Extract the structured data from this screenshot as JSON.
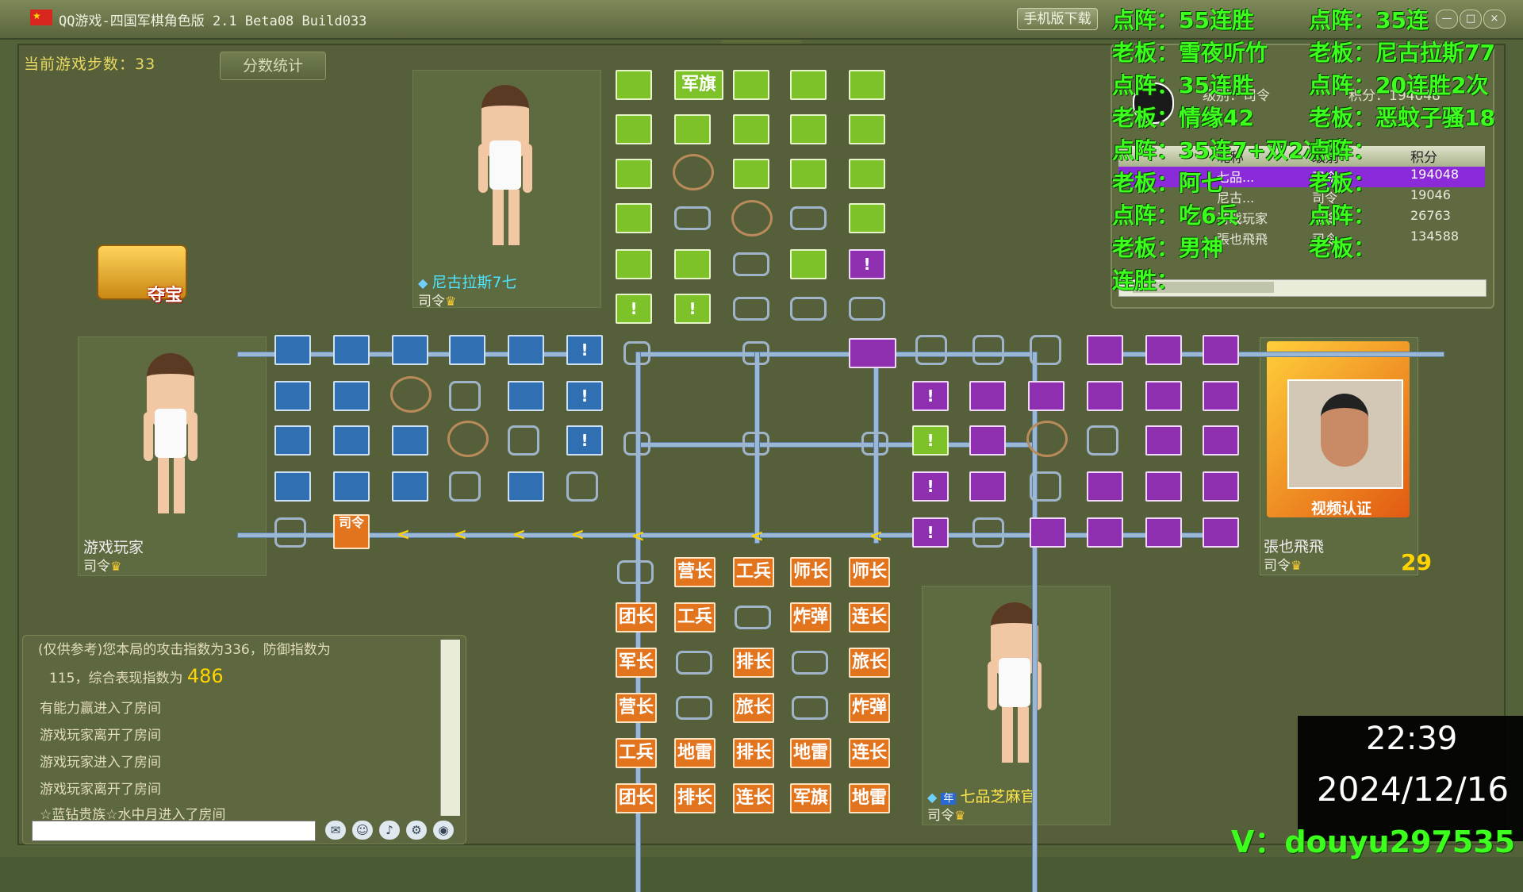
{
  "window": {
    "title": "QQ游戏-四国军棋角色版 2.1 Beta08 Build033",
    "mobile_button": "手机版下载",
    "controls": [
      "—",
      "□",
      "×"
    ]
  },
  "game": {
    "steps_label": "当前游戏步数：",
    "steps_value": "33",
    "score_stats_button": "分数统计",
    "treasure_label": "夺宝"
  },
  "players": {
    "top": {
      "name": "尼古拉斯7七",
      "rank": "司令"
    },
    "left": {
      "name": "游戏玩家",
      "rank": "司令"
    },
    "bottom": {
      "name": "七品芝麻官",
      "rank": "司令"
    },
    "right": {
      "name": "張也飛飛",
      "rank": "司令",
      "score": "29",
      "video_caption": "视频认证"
    }
  },
  "board": {
    "green_flag": "军旗",
    "mark": "!",
    "arrow": "<",
    "left_special": "司令",
    "orange_rows": [
      [
        "",
        "营长",
        "工兵",
        "师长",
        "师长"
      ],
      [
        "团长",
        "工兵",
        "",
        "炸弹",
        "连长"
      ],
      [
        "军长",
        "",
        "排长",
        "",
        "旅长"
      ],
      [
        "营长",
        "",
        "旅长",
        "",
        "炸弹"
      ],
      [
        "工兵",
        "地雷",
        "排长",
        "地雷",
        "连长"
      ],
      [
        "团长",
        "排长",
        "连长",
        "军旗",
        "地雷"
      ]
    ]
  },
  "scoreboard": {
    "headers": [
      "昵称",
      "级别",
      "积分"
    ],
    "rows": [
      {
        "name": "七品...",
        "level": "司令",
        "score": "194048",
        "selected": true
      },
      {
        "name": "尼古...",
        "level": "司令",
        "score": "19046",
        "selected": false
      },
      {
        "name": "游戏玩家",
        "level": "司令",
        "score": "26763",
        "selected": false
      },
      {
        "name": "張也飛飛",
        "level": "司令",
        "score": "134588",
        "selected": false
      }
    ],
    "info_level_label": "级别：司令",
    "info_score_label": "积分：194048"
  },
  "overlay": {
    "lines_left": [
      "点阵：55连胜",
      "老板：雪夜听竹",
      "点阵：35连胜",
      "老板：情缘42",
      "点阵：35连7+双2冲阵",
      "老板：阿七",
      "点阵：吃6兵",
      "老板：男神",
      "连胜："
    ],
    "lines_right": [
      "点阵：35连",
      "老板：尼古拉斯77",
      "点阵：20连胜2次",
      "老板：恶蚊子骚18",
      "点阵：",
      "老板：",
      "点阵：",
      "老板："
    ],
    "contact": "V：douyu297535"
  },
  "chat": {
    "lines": [
      "(仅供参考)您本局的攻击指数为336，防御指数为",
      "115，综合表现指数为",
      "有能力赢进入了房间",
      "游戏玩家离开了房间",
      "游戏玩家进入了房间",
      "游戏玩家离开了房间",
      "☆蓝钻贵族☆水中月进入了房间"
    ],
    "performance_index": "486",
    "input_value": ""
  },
  "clock": {
    "time": "22:39",
    "date": "2024/12/16"
  },
  "colors": {
    "green": "#7cc228",
    "blue": "#2f6fb2",
    "purple": "#8e2fb0",
    "orange": "#e2741e",
    "overlay_text": "#3cff1e"
  }
}
